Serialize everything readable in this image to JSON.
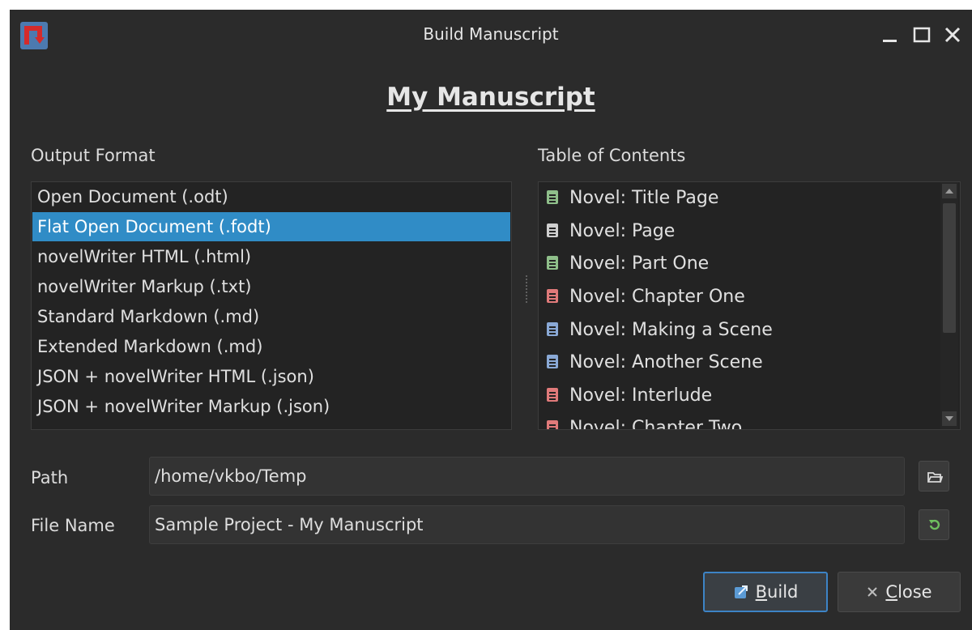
{
  "window": {
    "title": "Build Manuscript"
  },
  "heading": "My Manuscript",
  "output_format": {
    "label": "Output Format",
    "items": [
      "Open Document (.odt)",
      "Flat Open Document (.fodt)",
      "novelWriter HTML (.html)",
      "novelWriter Markup (.txt)",
      "Standard Markdown (.md)",
      "Extended Markdown (.md)",
      "JSON + novelWriter HTML (.json)",
      "JSON + novelWriter Markup (.json)"
    ],
    "selected": "Flat Open Document (.fodt)"
  },
  "toc": {
    "label": "Table of Contents",
    "items": [
      {
        "text": "Novel: Title Page",
        "color": "#8fbf8a"
      },
      {
        "text": "Novel: Page",
        "color": "#cfcfcf"
      },
      {
        "text": "Novel: Part One",
        "color": "#8fbf8a"
      },
      {
        "text": "Novel: Chapter One",
        "color": "#e07a7a"
      },
      {
        "text": "Novel: Making a Scene",
        "color": "#8aa9d6"
      },
      {
        "text": "Novel: Another Scene",
        "color": "#8aa9d6"
      },
      {
        "text": "Novel: Interlude",
        "color": "#e07a7a"
      },
      {
        "text": "Novel: Chapter Two",
        "color": "#e07a7a"
      }
    ]
  },
  "path": {
    "label": "Path",
    "value": "/home/vkbo/Temp"
  },
  "file_name": {
    "label": "File Name",
    "value": "Sample Project - My Manuscript"
  },
  "buttons": {
    "build_rest": "uild",
    "build_mnemonic": "B",
    "close_rest": "lose",
    "close_mnemonic": "C"
  },
  "colors": {
    "selection": "#308cc6",
    "accent": "#3d84c6",
    "reload": "#6fbf5f"
  },
  "icons": [
    "app-icon",
    "minimize-icon",
    "maximize-icon",
    "close-icon",
    "folder-open-icon",
    "reload-icon",
    "build-icon",
    "close-x-icon"
  ]
}
